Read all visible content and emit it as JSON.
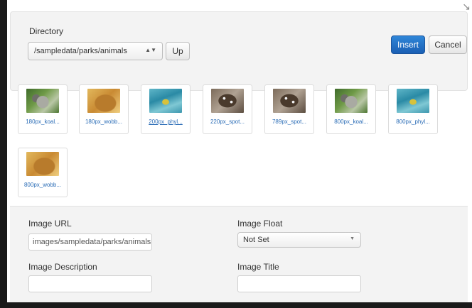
{
  "window": {
    "corner_icon": "↘"
  },
  "directory": {
    "label": "Directory",
    "selected": "/sampledata/parks/animals",
    "up_label": "Up"
  },
  "actions": {
    "insert_label": "Insert",
    "cancel_label": "Cancel"
  },
  "thumbnails": [
    {
      "caption": "180px_koal...",
      "icon": "koala"
    },
    {
      "caption": "180px_wobb...",
      "icon": "wombat"
    },
    {
      "caption": "200px_phyl...",
      "icon": "phyllopteryx"
    },
    {
      "caption": "220px_spot...",
      "icon": "spotted-quoll"
    },
    {
      "caption": "789px_spot...",
      "icon": "spotted-quoll"
    },
    {
      "caption": "800px_koal...",
      "icon": "koala"
    },
    {
      "caption": "800px_phyl...",
      "icon": "phyllopteryx"
    },
    {
      "caption": "800px_wobb...",
      "icon": "wombat"
    }
  ],
  "form": {
    "image_url_label": "Image URL",
    "image_url_value": "images/sampledata/parks/animals",
    "image_float_label": "Image Float",
    "image_float_value": "Not Set",
    "image_description_label": "Image Description",
    "image_description_value": "",
    "image_title_label": "Image Title",
    "image_title_value": ""
  },
  "colors": {
    "accent": "#1a5fb4",
    "link": "#2a6cb6",
    "panel": "#f3f3f3"
  }
}
